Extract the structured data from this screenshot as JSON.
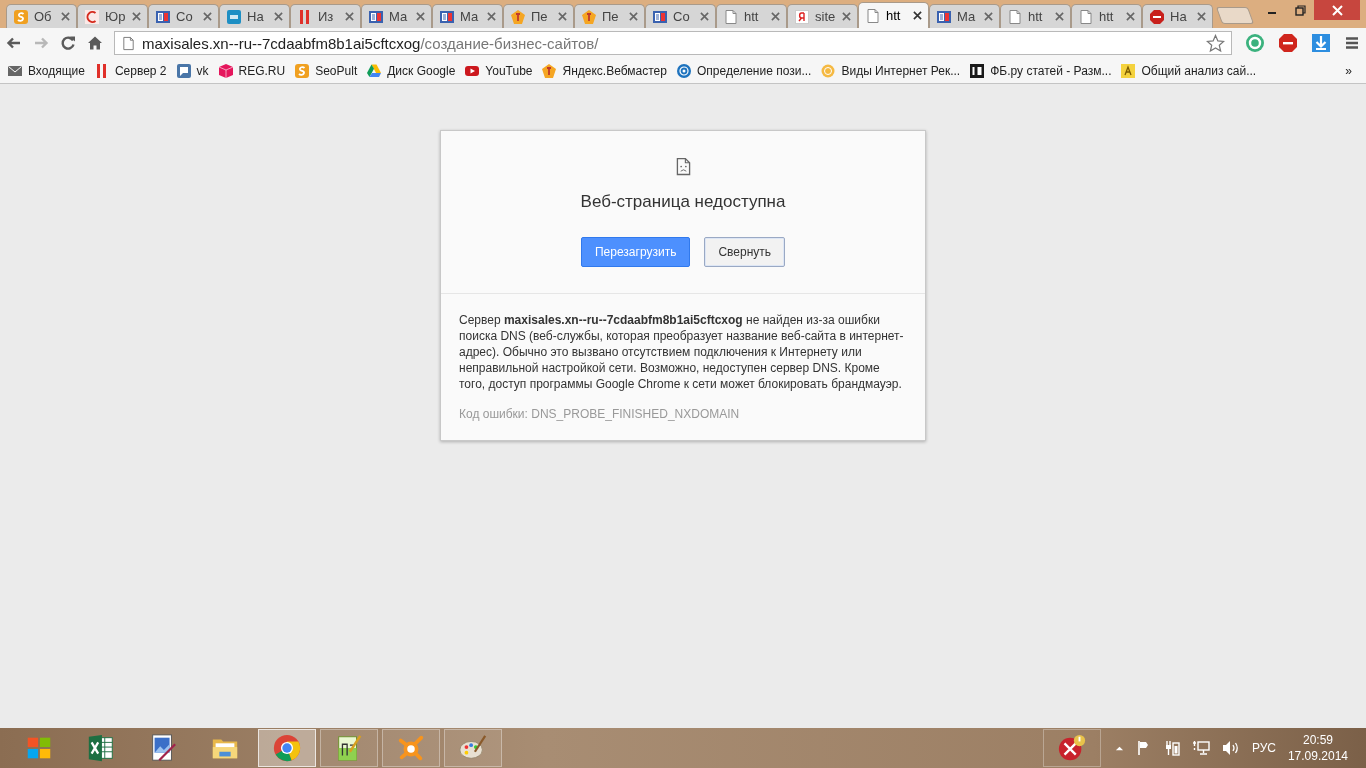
{
  "tabs": [
    {
      "kind": "s",
      "title": "Об",
      "selected": false
    },
    {
      "kind": "c",
      "title": "Юр",
      "selected": false
    },
    {
      "kind": "form",
      "title": "Со",
      "selected": false
    },
    {
      "kind": "gb",
      "title": "На",
      "selected": false
    },
    {
      "kind": "bars",
      "title": "Из",
      "selected": false
    },
    {
      "kind": "form",
      "title": "Ма",
      "selected": false
    },
    {
      "kind": "form",
      "title": "Ма",
      "selected": false
    },
    {
      "kind": "ya",
      "title": "Пе",
      "selected": false
    },
    {
      "kind": "ya",
      "title": "Пе",
      "selected": false
    },
    {
      "kind": "form",
      "title": "Со",
      "selected": false
    },
    {
      "kind": "page",
      "title": "htt",
      "selected": false
    },
    {
      "kind": "tile",
      "title": "site",
      "selected": false
    },
    {
      "kind": "page",
      "title": "htt",
      "selected": true
    },
    {
      "kind": "form",
      "title": "Ма",
      "selected": false
    },
    {
      "kind": "page",
      "title": "htt",
      "selected": false
    },
    {
      "kind": "page",
      "title": "htt",
      "selected": false
    },
    {
      "kind": "abp",
      "title": "На",
      "selected": false
    }
  ],
  "nav": [
    {
      "kind": "back",
      "disabled": false
    },
    {
      "kind": "forward",
      "disabled": true
    },
    {
      "kind": "reload",
      "disabled": false
    },
    {
      "kind": "home",
      "disabled": false
    }
  ],
  "address": {
    "host": "maxisales.xn--ru--7cdaabfm8b1ai5cftcxog",
    "path": "/создание-бизнес-сайтов/"
  },
  "extensions": [
    {
      "kind": "ring"
    },
    {
      "kind": "abp"
    },
    {
      "kind": "download"
    },
    {
      "kind": "menu"
    }
  ],
  "bookmarks": [
    {
      "kind": "mail",
      "label": "Входящие"
    },
    {
      "kind": "bars",
      "label": "Сервер 2"
    },
    {
      "kind": "chat",
      "label": "vk"
    },
    {
      "kind": "cube",
      "label": "REG.RU"
    },
    {
      "kind": "s",
      "label": "SeoPult"
    },
    {
      "kind": "triangle",
      "label": "Диск Google"
    },
    {
      "kind": "play",
      "label": "YouTube"
    },
    {
      "kind": "ya",
      "label": "Яндекс.Вебмастер"
    },
    {
      "kind": "globe",
      "label": "Определение пози..."
    },
    {
      "kind": "coin",
      "label": "Виды Интернет Рек..."
    },
    {
      "kind": "dark",
      "label": "ФБ.ру статей - Разм..."
    },
    {
      "kind": "yellow",
      "label": "Общий анализ сай..."
    }
  ],
  "bookmarks_more": "»",
  "error": {
    "title": "Веб-страница недоступна",
    "buttons": [
      {
        "label": "Перезагрузить",
        "kind": "primary"
      },
      {
        "label": "Свернуть",
        "kind": "secondary"
      }
    ],
    "details": "Сервер **maxisales.xn--ru--7cdaabfm8b1ai5cftcxog** не найден из-за ошибки поиска DNS (веб-службы, которая преобразует название веб-сайта в интернет-адрес). Обычно это вызвано отсутствием подключения к Интернету или неправильной настройкой сети. Возможно, недоступен сервер DNS. Кроме того, доступ программы Google Chrome к сети может блокировать брандмауэр.",
    "error_code": "Код ошибки: DNS_PROBE_FINISHED_NXDOMAIN"
  },
  "taskbar": {
    "apps": [
      {
        "kind": "start",
        "running": false,
        "selected": false
      },
      {
        "kind": "sheet",
        "running": false,
        "selected": false
      },
      {
        "kind": "board",
        "running": false,
        "selected": false
      },
      {
        "kind": "folder",
        "running": false,
        "selected": false
      },
      {
        "kind": "browser",
        "running": true,
        "selected": true
      },
      {
        "kind": "notepad",
        "running": true,
        "selected": false
      },
      {
        "kind": "splat",
        "running": true,
        "selected": false
      },
      {
        "kind": "palette",
        "running": true,
        "selected": false
      }
    ],
    "language": "РУС",
    "time": "20:59",
    "date": "17.09.2014"
  }
}
